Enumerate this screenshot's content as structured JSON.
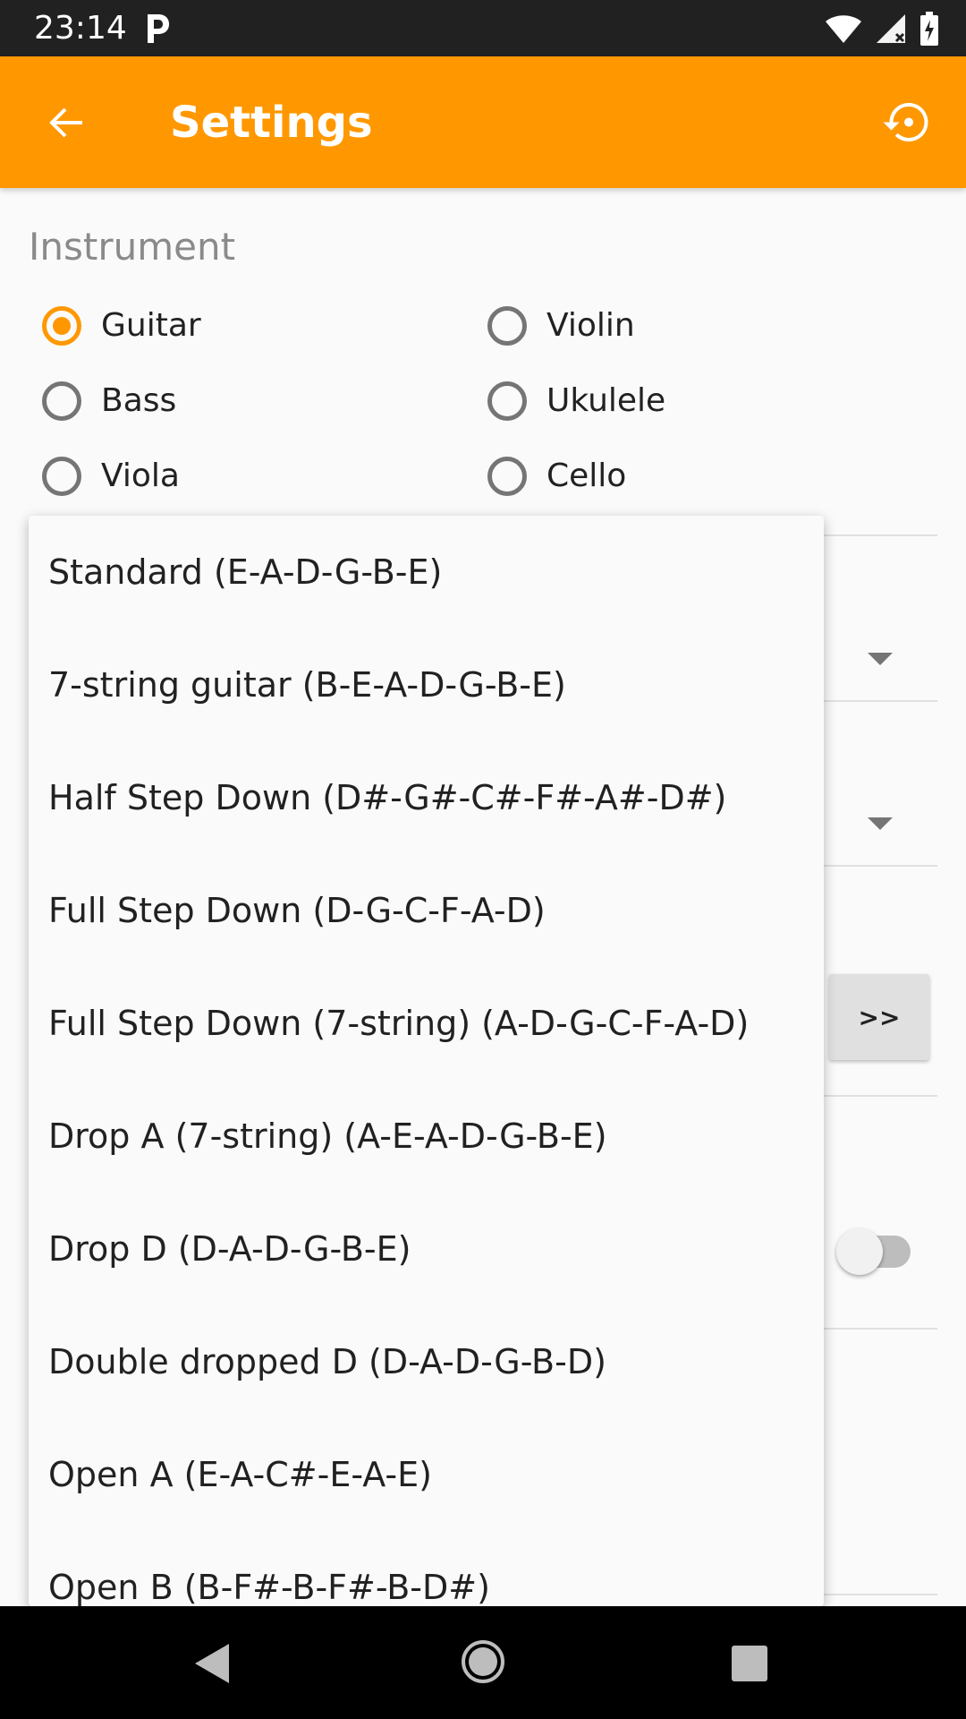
{
  "status_bar": {
    "time": "23:14",
    "notification_icon": "parking-p-icon",
    "icons": [
      "wifi-icon",
      "signal-icon",
      "battery-icon"
    ]
  },
  "app_bar": {
    "title": "Settings",
    "back_icon": "arrow-left-icon",
    "restore_icon": "restore-icon",
    "color": "#FF9800"
  },
  "instrument": {
    "title": "Instrument",
    "options": [
      {
        "label": "Guitar",
        "checked": true
      },
      {
        "label": "Violin",
        "checked": false
      },
      {
        "label": "Bass",
        "checked": false
      },
      {
        "label": "Ukulele",
        "checked": false
      },
      {
        "label": "Viola",
        "checked": false
      },
      {
        "label": "Cello",
        "checked": false
      }
    ]
  },
  "next_button": {
    "label": ">>"
  },
  "tuning_popup": {
    "items": [
      "Standard (E-A-D-G-B-E)",
      "7-string guitar (B-E-A-D-G-B-E)",
      "Half Step Down (D#-G#-C#-F#-A#-D#)",
      "Full Step Down (D-G-C-F-A-D)",
      "Full Step Down (7-string) (A-D-G-C-F-A-D)",
      "Drop A (7-string) (A-E-A-D-G-B-E)",
      "Drop D (D-A-D-G-B-E)",
      "Double dropped D (D-A-D-G-B-D)",
      "Open A (E-A-C#-E-A-E)",
      "Open B (B-F#-B-F#-B-D#)"
    ]
  },
  "toggle": {
    "on": false
  },
  "nav_bar": {
    "icons": [
      "nav-back-icon",
      "nav-home-icon",
      "nav-recents-icon"
    ]
  }
}
